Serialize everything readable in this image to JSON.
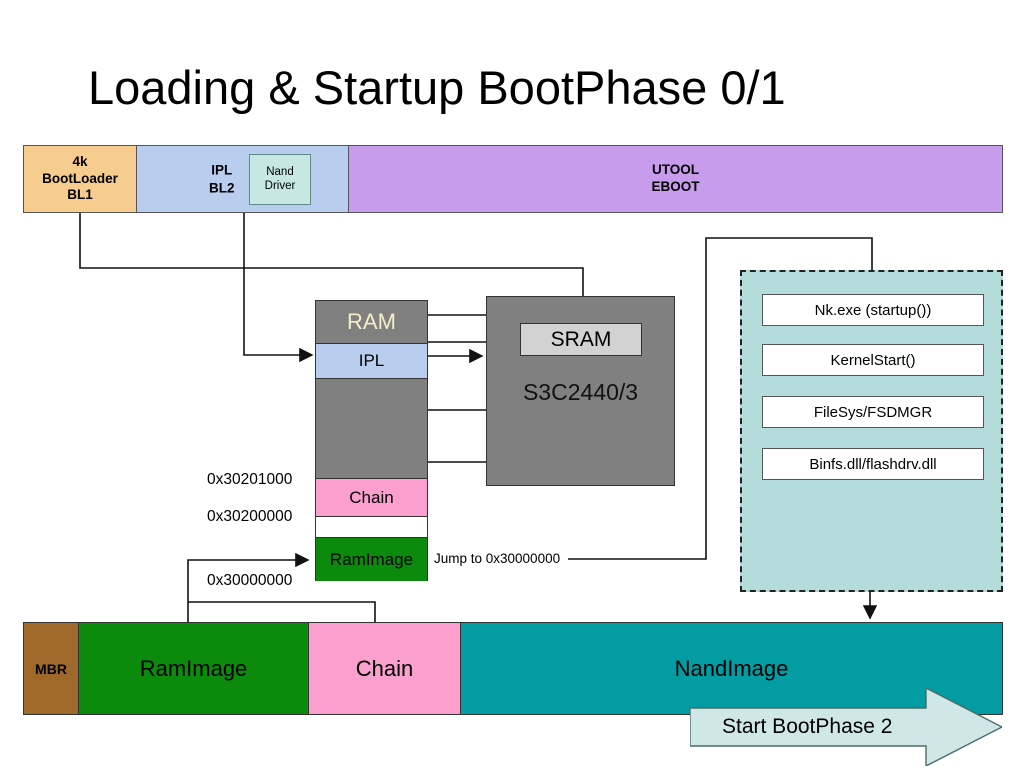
{
  "title": "Loading & Startup BootPhase 0/1",
  "flash_layout_bar": {
    "segments": [
      {
        "name": "bl1",
        "label": "4k\nBootLoader\nBL1",
        "color": "#f7cc8f"
      },
      {
        "name": "bl2",
        "label": "IPL\nBL2",
        "color": "#b9cdee",
        "inner_box": "Nand\nDriver",
        "inner_color": "#c7e8e2"
      },
      {
        "name": "eboot",
        "label": "UTOOL\nEBOOT",
        "color": "#c89cec"
      }
    ],
    "bl1_label_line1": "4k",
    "bl1_label_line2": "BootLoader",
    "bl1_label_line3": "BL1",
    "bl2_label_line1": "IPL",
    "bl2_label_line2": "BL2",
    "nand_driver_line1": "Nand",
    "nand_driver_line2": "Driver",
    "eboot_label_line1": "UTOOL",
    "eboot_label_line2": "EBOOT"
  },
  "ram": {
    "title": "RAM",
    "ipl": "IPL",
    "chain": "Chain",
    "ramimage": "RamImage",
    "addresses": {
      "chain_top": "0x30201000",
      "chain_bottom": "0x30200000",
      "ramimage_base": "0x30000000"
    },
    "ram_color": "#808080",
    "ipl_color": "#b9cdee",
    "chain_color": "#fa9fce",
    "ramimage_color": "#0b8a0b"
  },
  "soc": {
    "sram": "SRAM",
    "name": "S3C2440/3",
    "color": "#808080",
    "sram_color": "#d2d2d2"
  },
  "jump_label": "Jump to 0x30000000",
  "os_panel": {
    "background": "#b3dcdb",
    "boxes": [
      {
        "label": "Nk.exe (startup())"
      },
      {
        "label": "KernelStart()"
      },
      {
        "label": "FileSys/FSDMGR"
      },
      {
        "label": "Binfs.dll/flashdrv.dll"
      }
    ]
  },
  "nand_bar": {
    "segments": [
      {
        "name": "mbr",
        "label": "MBR",
        "color": "#a0692c"
      },
      {
        "name": "ramimage",
        "label": "RamImage",
        "color": "#0b8a0b"
      },
      {
        "name": "chain",
        "label": "Chain",
        "color": "#fa9fce"
      },
      {
        "name": "nandimage",
        "label": "NandImage",
        "color": "#029ca2"
      }
    ]
  },
  "start_arrow": {
    "label": "Start BootPhase 2",
    "fill": "#cfe7e7",
    "stroke": "#4b6b6b"
  }
}
